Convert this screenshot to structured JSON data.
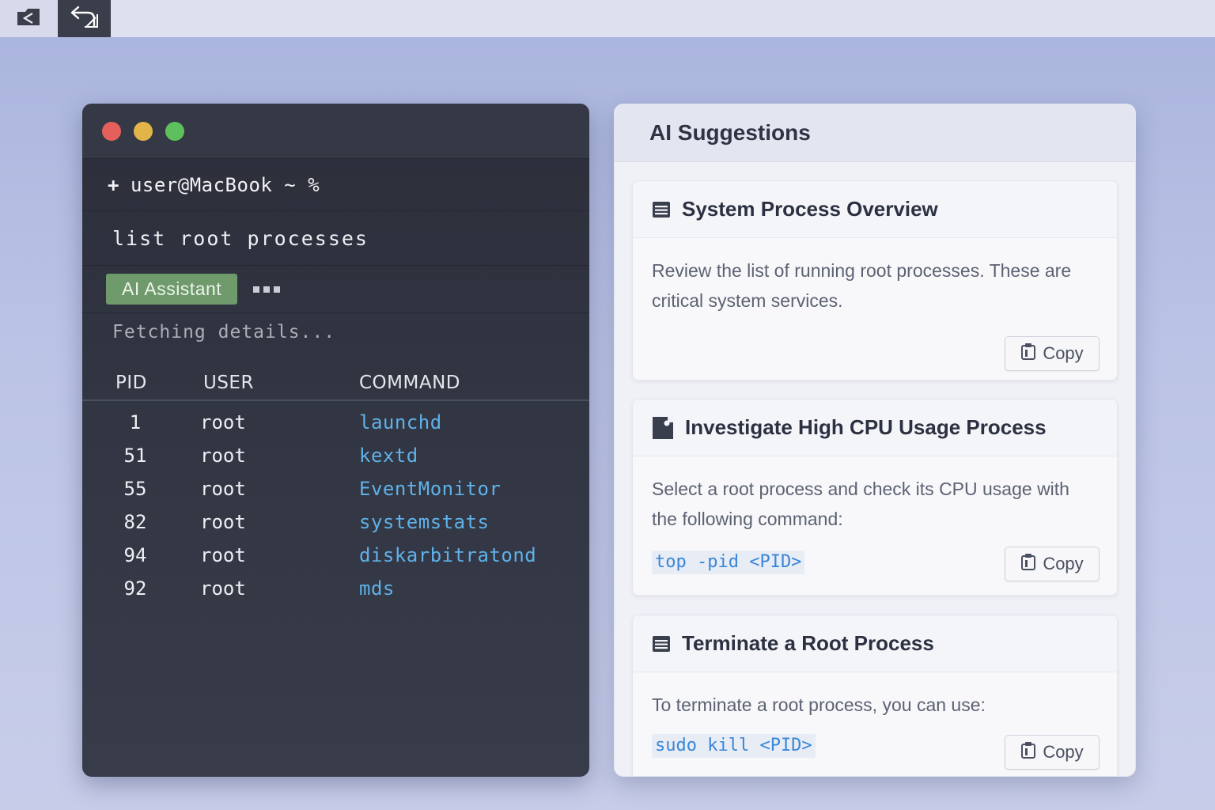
{
  "toolbar": {
    "back_icon": "back-window-icon",
    "undo_icon": "undo-arrow-icon"
  },
  "terminal": {
    "prompt_symbol": "+",
    "prompt": "user@MacBook ~ %",
    "command": "list root processes",
    "assistant_badge": "AI Assistant",
    "status": "Fetching details...",
    "columns": [
      "PID",
      "USER",
      "COMMAND"
    ],
    "rows": [
      {
        "pid": "1",
        "user": "root",
        "command": "launchd"
      },
      {
        "pid": "51",
        "user": "root",
        "command": "kextd"
      },
      {
        "pid": "55",
        "user": "root",
        "command": "EventMonitor"
      },
      {
        "pid": "82",
        "user": "root",
        "command": "systemstats"
      },
      {
        "pid": "94",
        "user": "root",
        "command": "diskarbitratond"
      },
      {
        "pid": "92",
        "user": "root",
        "command": "mds"
      }
    ]
  },
  "suggestions": {
    "title": "AI Suggestions",
    "cards": [
      {
        "title": "System Process Overview",
        "body": "Review the list of running root processes. These are critical system services.",
        "code": "",
        "copy_label": "Copy",
        "icon": "list-icon"
      },
      {
        "title": "Investigate High CPU Usage Process",
        "body": "Select a root process and check its CPU usage with the following command:",
        "code": "top -pid <PID>",
        "copy_label": "Copy",
        "icon": "document-icon"
      },
      {
        "title": "Terminate a Root Process",
        "body": "To terminate a root process, you can use:",
        "code": "sudo kill <PID>",
        "copy_label": "Copy",
        "icon": "list-icon"
      }
    ]
  },
  "colors": {
    "accent_green": "#6e9a6c",
    "command_blue": "#5fb1e8",
    "code_blue": "#3a86d8"
  }
}
